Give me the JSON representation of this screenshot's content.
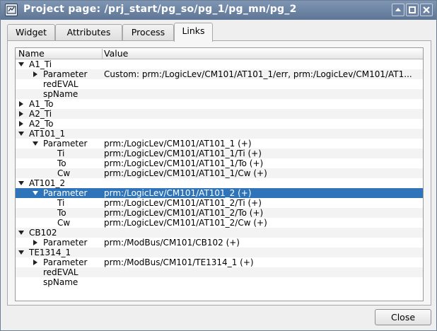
{
  "window": {
    "title": "Project page: /prj_start/pg_so/pg_1/pg_mn/pg_2",
    "icon": "settings-dialog-icon",
    "controls": [
      "shade-icon",
      "maximize-icon",
      "close-icon"
    ]
  },
  "tabs": [
    {
      "label": "Widget",
      "active": false
    },
    {
      "label": "Attributes",
      "active": false
    },
    {
      "label": "Process",
      "active": false
    },
    {
      "label": "Links",
      "active": true
    }
  ],
  "tree": {
    "columns": [
      "Name",
      "Value"
    ],
    "rows": [
      {
        "level": 0,
        "arrow": "down",
        "name": "A1_Ti",
        "value": ""
      },
      {
        "level": 1,
        "arrow": "right",
        "name": "Parameter",
        "value": "Custom: prm:/LogicLev/CM101/AT101_1/err, prm:/LogicLev/CM101/AT1..."
      },
      {
        "level": 1,
        "arrow": "none",
        "name": "redEVAL",
        "value": ""
      },
      {
        "level": 1,
        "arrow": "none",
        "name": "spName",
        "value": ""
      },
      {
        "level": 0,
        "arrow": "right",
        "name": "A1_To",
        "value": ""
      },
      {
        "level": 0,
        "arrow": "right",
        "name": "A2_Ti",
        "value": ""
      },
      {
        "level": 0,
        "arrow": "right",
        "name": "A2_To",
        "value": ""
      },
      {
        "level": 0,
        "arrow": "down",
        "name": "AT101_1",
        "value": ""
      },
      {
        "level": 1,
        "arrow": "down",
        "name": "Parameter",
        "value": "prm:/LogicLev/CM101/AT101_1 (+)"
      },
      {
        "level": 2,
        "arrow": "none",
        "name": "Ti",
        "value": "prm:/LogicLev/CM101/AT101_1/Ti (+)"
      },
      {
        "level": 2,
        "arrow": "none",
        "name": "To",
        "value": "prm:/LogicLev/CM101/AT101_1/To (+)"
      },
      {
        "level": 2,
        "arrow": "none",
        "name": "Cw",
        "value": "prm:/LogicLev/CM101/AT101_1/Cw (+)"
      },
      {
        "level": 0,
        "arrow": "down",
        "name": "AT101_2",
        "value": ""
      },
      {
        "level": 1,
        "arrow": "down",
        "name": "Parameter",
        "value": "prm:/LogicLev/CM101/AT101_2 (+)",
        "selected": true
      },
      {
        "level": 2,
        "arrow": "none",
        "name": "Ti",
        "value": "prm:/LogicLev/CM101/AT101_2/Ti (+)"
      },
      {
        "level": 2,
        "arrow": "none",
        "name": "To",
        "value": "prm:/LogicLev/CM101/AT101_2/To (+)"
      },
      {
        "level": 2,
        "arrow": "none",
        "name": "Cw",
        "value": "prm:/LogicLev/CM101/AT101_2/Cw (+)"
      },
      {
        "level": 0,
        "arrow": "down",
        "name": "CB102",
        "value": ""
      },
      {
        "level": 1,
        "arrow": "right",
        "name": "Parameter",
        "value": "prm:/ModBus/CM101/CB102 (+)"
      },
      {
        "level": 0,
        "arrow": "down",
        "name": "TE1314_1",
        "value": ""
      },
      {
        "level": 1,
        "arrow": "right",
        "name": "Parameter",
        "value": "prm:/ModBus/CM101/TE1314_1 (+)"
      },
      {
        "level": 1,
        "arrow": "none",
        "name": "redEVAL",
        "value": ""
      },
      {
        "level": 1,
        "arrow": "none",
        "name": "spName",
        "value": ""
      }
    ]
  },
  "buttons": {
    "close": "Close"
  },
  "colors": {
    "titlebar": "#6a81a1",
    "selection": "#2f74b8",
    "selection_text": "#ffffff"
  }
}
